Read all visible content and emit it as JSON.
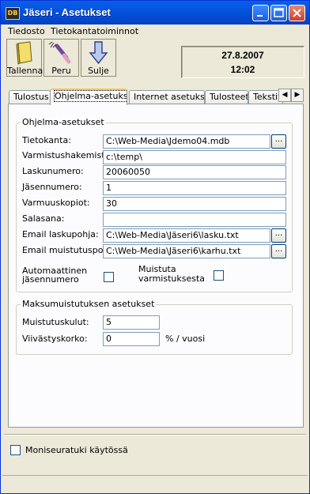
{
  "window": {
    "title": "Jäseri - Asetukset",
    "icon": "app-icon"
  },
  "menu": [
    "Tiedosto",
    "Tietokantatoiminnot"
  ],
  "toolbar": [
    {
      "label": "Tallenna",
      "icon": "save-book-icon"
    },
    {
      "label": "Peru",
      "icon": "undo-brush-icon"
    },
    {
      "label": "Sulje",
      "icon": "close-arrow-icon"
    }
  ],
  "datetime": {
    "date": "27.8.2007",
    "time": "12:02"
  },
  "tabs": [
    "Tulostus",
    "Ohjelma-asetukset",
    "Internet asetukset",
    "Tulosteet",
    "Tekstit"
  ],
  "active_tab": "Ohjelma-asetukset",
  "program": {
    "title": "Ohjelma-asetukset",
    "fields": [
      {
        "label": "Tietokanta:",
        "value": "C:\\Web-Media\\Jdemo04.mdb",
        "browse": "..."
      },
      {
        "label": "Varmistushakemisto:",
        "value": "c:\\temp\\"
      },
      {
        "label": "Laskunumero:",
        "value": "20060050"
      },
      {
        "label": "Jäsennumero:",
        "value": "1"
      },
      {
        "label": "Varmuuskopiot:",
        "value": "30"
      },
      {
        "label": "Salasana:",
        "value": ""
      },
      {
        "label": "Email laskupohja:",
        "value": "C:\\Web-Media\\Jäseri6\\lasku.txt",
        "browse": "..."
      },
      {
        "label": "Email muistutuspohj:",
        "value": "C:\\Web-Media\\Jäseri6\\karhu.txt",
        "browse": "..."
      }
    ],
    "auto_number": {
      "line1": "Automaattinen",
      "line2": "jäsennumero",
      "checked": false
    },
    "remind_backup": {
      "line1": "Muistuta",
      "line2": "varmistuksesta",
      "checked": false
    }
  },
  "reminder": {
    "title": "Maksumuistutuksen asetukset",
    "fee_label": "Muistutuskulut:",
    "fee_value": "5",
    "interest_label": "Viivästyskorko:",
    "interest_value": "0",
    "interest_unit": "% / vuosi"
  },
  "multiclub": {
    "label": "Moniseuratuki käytössä",
    "checked": false
  }
}
